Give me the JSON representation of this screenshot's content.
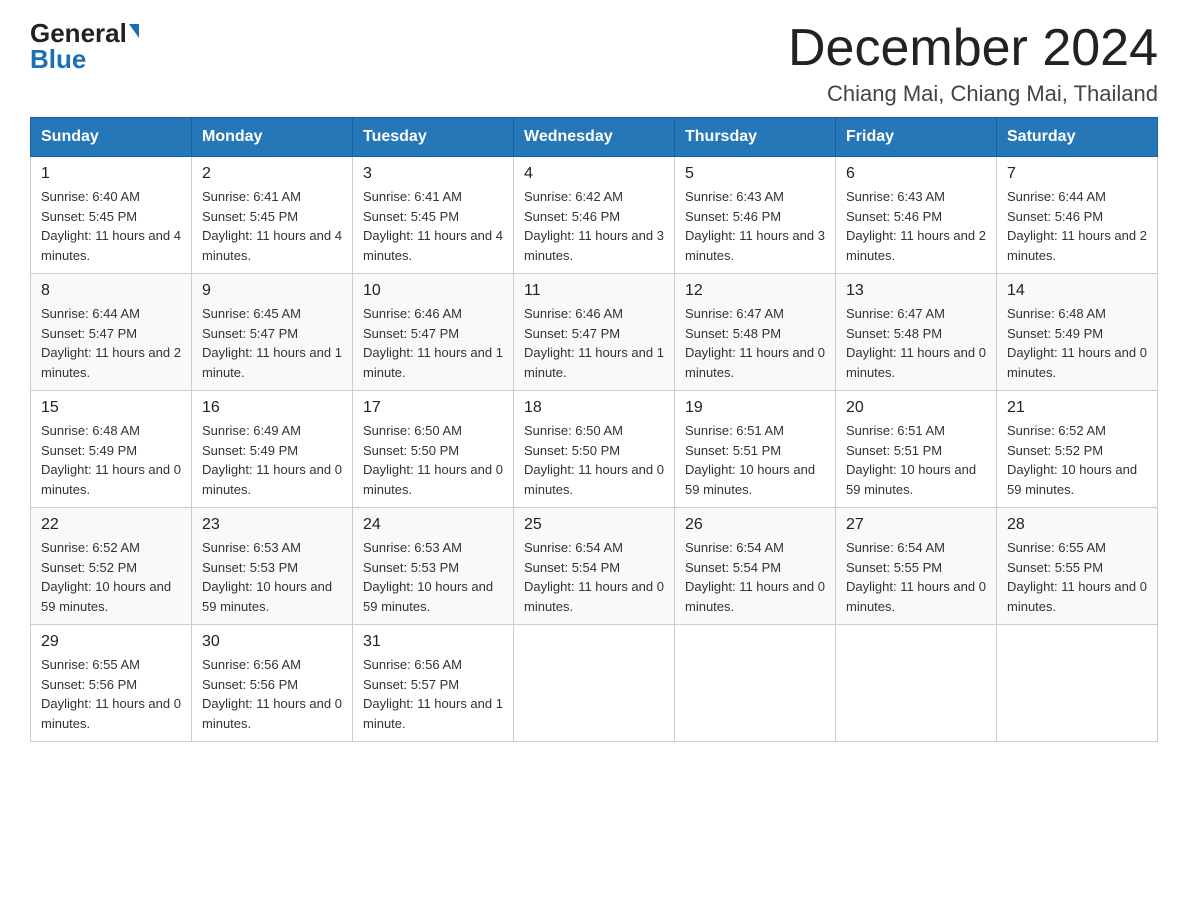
{
  "logo": {
    "general": "General",
    "blue": "Blue"
  },
  "title": {
    "month": "December 2024",
    "location": "Chiang Mai, Chiang Mai, Thailand"
  },
  "days_of_week": [
    "Sunday",
    "Monday",
    "Tuesday",
    "Wednesday",
    "Thursday",
    "Friday",
    "Saturday"
  ],
  "weeks": [
    [
      {
        "day": "1",
        "sunrise": "6:40 AM",
        "sunset": "5:45 PM",
        "daylight": "11 hours and 4 minutes."
      },
      {
        "day": "2",
        "sunrise": "6:41 AM",
        "sunset": "5:45 PM",
        "daylight": "11 hours and 4 minutes."
      },
      {
        "day": "3",
        "sunrise": "6:41 AM",
        "sunset": "5:45 PM",
        "daylight": "11 hours and 4 minutes."
      },
      {
        "day": "4",
        "sunrise": "6:42 AM",
        "sunset": "5:46 PM",
        "daylight": "11 hours and 3 minutes."
      },
      {
        "day": "5",
        "sunrise": "6:43 AM",
        "sunset": "5:46 PM",
        "daylight": "11 hours and 3 minutes."
      },
      {
        "day": "6",
        "sunrise": "6:43 AM",
        "sunset": "5:46 PM",
        "daylight": "11 hours and 2 minutes."
      },
      {
        "day": "7",
        "sunrise": "6:44 AM",
        "sunset": "5:46 PM",
        "daylight": "11 hours and 2 minutes."
      }
    ],
    [
      {
        "day": "8",
        "sunrise": "6:44 AM",
        "sunset": "5:47 PM",
        "daylight": "11 hours and 2 minutes."
      },
      {
        "day": "9",
        "sunrise": "6:45 AM",
        "sunset": "5:47 PM",
        "daylight": "11 hours and 1 minute."
      },
      {
        "day": "10",
        "sunrise": "6:46 AM",
        "sunset": "5:47 PM",
        "daylight": "11 hours and 1 minute."
      },
      {
        "day": "11",
        "sunrise": "6:46 AM",
        "sunset": "5:47 PM",
        "daylight": "11 hours and 1 minute."
      },
      {
        "day": "12",
        "sunrise": "6:47 AM",
        "sunset": "5:48 PM",
        "daylight": "11 hours and 0 minutes."
      },
      {
        "day": "13",
        "sunrise": "6:47 AM",
        "sunset": "5:48 PM",
        "daylight": "11 hours and 0 minutes."
      },
      {
        "day": "14",
        "sunrise": "6:48 AM",
        "sunset": "5:49 PM",
        "daylight": "11 hours and 0 minutes."
      }
    ],
    [
      {
        "day": "15",
        "sunrise": "6:48 AM",
        "sunset": "5:49 PM",
        "daylight": "11 hours and 0 minutes."
      },
      {
        "day": "16",
        "sunrise": "6:49 AM",
        "sunset": "5:49 PM",
        "daylight": "11 hours and 0 minutes."
      },
      {
        "day": "17",
        "sunrise": "6:50 AM",
        "sunset": "5:50 PM",
        "daylight": "11 hours and 0 minutes."
      },
      {
        "day": "18",
        "sunrise": "6:50 AM",
        "sunset": "5:50 PM",
        "daylight": "11 hours and 0 minutes."
      },
      {
        "day": "19",
        "sunrise": "6:51 AM",
        "sunset": "5:51 PM",
        "daylight": "10 hours and 59 minutes."
      },
      {
        "day": "20",
        "sunrise": "6:51 AM",
        "sunset": "5:51 PM",
        "daylight": "10 hours and 59 minutes."
      },
      {
        "day": "21",
        "sunrise": "6:52 AM",
        "sunset": "5:52 PM",
        "daylight": "10 hours and 59 minutes."
      }
    ],
    [
      {
        "day": "22",
        "sunrise": "6:52 AM",
        "sunset": "5:52 PM",
        "daylight": "10 hours and 59 minutes."
      },
      {
        "day": "23",
        "sunrise": "6:53 AM",
        "sunset": "5:53 PM",
        "daylight": "10 hours and 59 minutes."
      },
      {
        "day": "24",
        "sunrise": "6:53 AM",
        "sunset": "5:53 PM",
        "daylight": "10 hours and 59 minutes."
      },
      {
        "day": "25",
        "sunrise": "6:54 AM",
        "sunset": "5:54 PM",
        "daylight": "11 hours and 0 minutes."
      },
      {
        "day": "26",
        "sunrise": "6:54 AM",
        "sunset": "5:54 PM",
        "daylight": "11 hours and 0 minutes."
      },
      {
        "day": "27",
        "sunrise": "6:54 AM",
        "sunset": "5:55 PM",
        "daylight": "11 hours and 0 minutes."
      },
      {
        "day": "28",
        "sunrise": "6:55 AM",
        "sunset": "5:55 PM",
        "daylight": "11 hours and 0 minutes."
      }
    ],
    [
      {
        "day": "29",
        "sunrise": "6:55 AM",
        "sunset": "5:56 PM",
        "daylight": "11 hours and 0 minutes."
      },
      {
        "day": "30",
        "sunrise": "6:56 AM",
        "sunset": "5:56 PM",
        "daylight": "11 hours and 0 minutes."
      },
      {
        "day": "31",
        "sunrise": "6:56 AM",
        "sunset": "5:57 PM",
        "daylight": "11 hours and 1 minute."
      },
      null,
      null,
      null,
      null
    ]
  ]
}
